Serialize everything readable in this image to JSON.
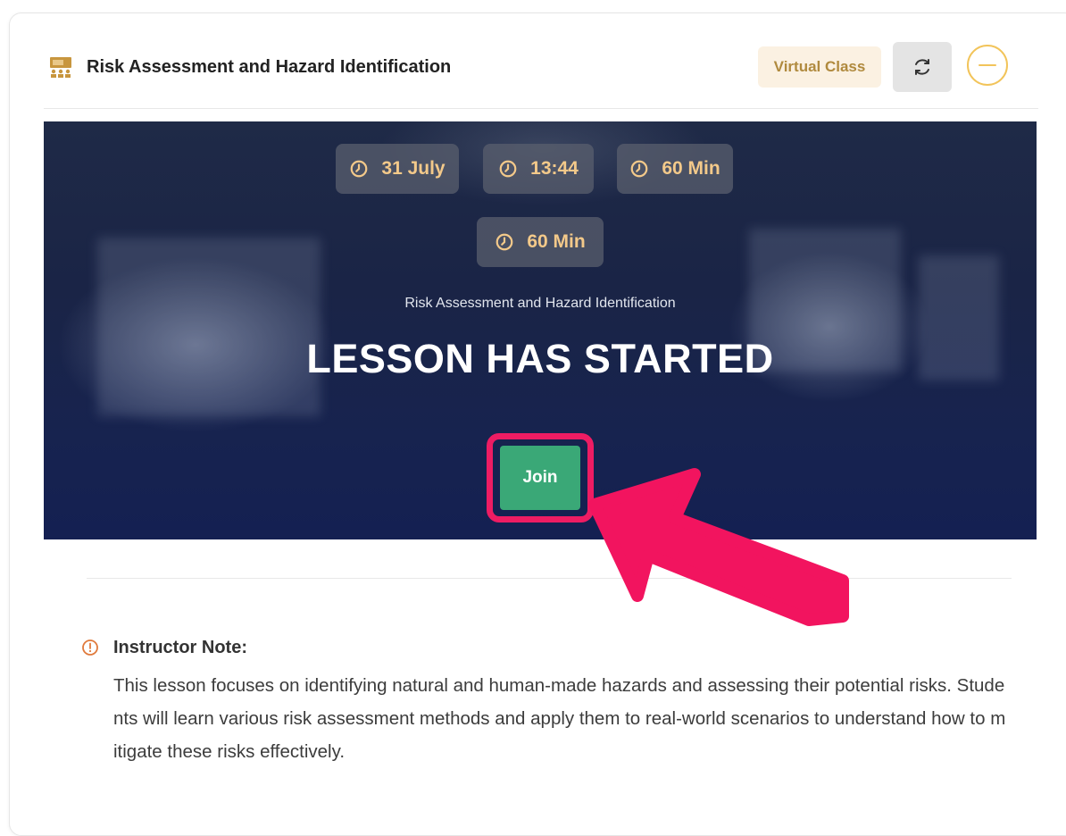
{
  "header": {
    "title": "Risk Assessment and Hazard Identification",
    "badge": "Virtual Class",
    "icons": {
      "title": "classroom-icon",
      "refresh": "refresh-icon",
      "collapse": "minus-circle-icon"
    }
  },
  "banner": {
    "pills": [
      {
        "icon": "clock-icon",
        "text": "31 July"
      },
      {
        "icon": "clock-icon",
        "text": "13:44"
      },
      {
        "icon": "clock-icon",
        "text": "60 Min"
      },
      {
        "icon": "clock-icon",
        "text": "60 Min"
      }
    ],
    "subtitle": "Risk Assessment and Hazard Identification",
    "headline": "LESSON HAS STARTED",
    "join_label": "Join"
  },
  "note": {
    "icon": "info-icon",
    "title": "Instructor Note:",
    "body": "This lesson focuses on identifying natural and human-made hazards and assessing their potential risks. Students will learn various risk assessment methods and apply them to real-world scenarios to understand how to mitigate these risks effectively."
  },
  "colors": {
    "accent": "#f3c98a",
    "badge_bg": "#fbf1e2",
    "badge_text": "#b08a3e",
    "join_green": "#3aa877",
    "highlight_pink": "#ee1c63",
    "note_icon": "#e07a3c",
    "banner_dark": "#17234f"
  }
}
